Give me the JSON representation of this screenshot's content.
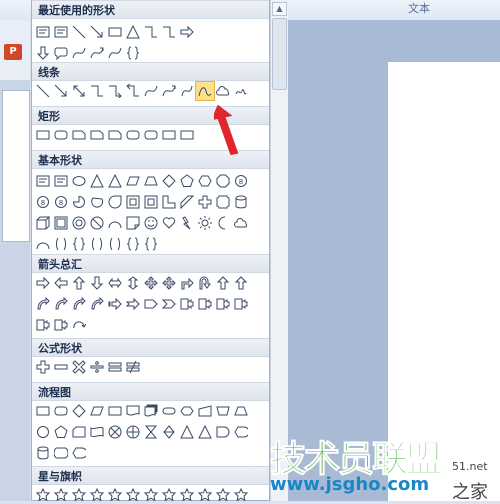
{
  "ribbon": {
    "text_tab": "文本"
  },
  "app": {
    "icon_glyph": "P"
  },
  "watermark": {
    "line1": "技术员联盟",
    "line2": "www.jsgho.com",
    "site_suffix": "51.net",
    "line3": "之家"
  },
  "sections": [
    {
      "title": "最近使用的形状",
      "rows": [
        [
          "textbox",
          "textbox",
          "line",
          "arrow-line",
          "rect",
          "triangle",
          "elbow",
          "elbow",
          "arrow-right"
        ],
        [
          "arrow-down",
          "rounded-callout",
          "curve",
          "curved-arrow",
          "curve",
          "brace"
        ]
      ]
    },
    {
      "title": "线条",
      "rows": [
        [
          "line",
          "arrow-line",
          "dbl-arrow-line",
          "elbow",
          "elbow-arrow",
          "elbow-dbl",
          "curve",
          "curved-arrow",
          "curved-dbl",
          "freeform-selected",
          "cloud",
          "scribble"
        ]
      ]
    },
    {
      "title": "矩形",
      "rows": [
        [
          "rect",
          "round-rect",
          "snip-rect",
          "snip-rect",
          "snip-rect",
          "round-rect",
          "round-rect",
          "rect",
          "rect"
        ]
      ]
    },
    {
      "title": "基本形状",
      "rows": [
        [
          "textbox",
          "textbox",
          "ellipse",
          "triangle",
          "triangle",
          "parallelogram",
          "trapezoid",
          "diamond",
          "pentagon",
          "hexagon",
          "octagon",
          "circle-num"
        ],
        [
          "circle-num",
          "circle-num",
          "pie",
          "chord",
          "teardrop",
          "frame",
          "frame",
          "lshape",
          "diag-stripe",
          "plus",
          "plaque",
          "can"
        ],
        [
          "cube",
          "bevel",
          "donut",
          "noentry",
          "arc",
          "folded",
          "smiley",
          "heart",
          "lightning",
          "sun",
          "moon",
          "cloud"
        ],
        [
          "arc",
          "bracket",
          "brace",
          "bracket",
          "bracket",
          "brace",
          "brace"
        ]
      ]
    },
    {
      "title": "箭头总汇",
      "rows": [
        [
          "arrow-right",
          "arrow-left",
          "arrow-up",
          "arrow-down",
          "arrow-lr",
          "arrow-ud",
          "arrow-quad",
          "arrow-quad",
          "arrow-bent",
          "arrow-uturn",
          "arrow-up",
          "arrow-up"
        ],
        [
          "arrow-curve",
          "arrow-curve",
          "arrow-curve",
          "arrow-curve",
          "arrow-striped",
          "arrow-notch",
          "pentagon-arrow",
          "chevron",
          "callout",
          "callout",
          "callout",
          "callout"
        ],
        [
          "callout",
          "callout",
          "circular-arrow"
        ]
      ]
    },
    {
      "title": "公式形状",
      "rows": [
        [
          "plus",
          "minus",
          "multiply",
          "divide",
          "equal",
          "notequal"
        ]
      ]
    },
    {
      "title": "流程图",
      "rows": [
        [
          "rect",
          "round-rect",
          "diamond",
          "parallelogram",
          "rect",
          "doc",
          "multidoc",
          "terminator",
          "prep",
          "manual-input",
          "manual-op",
          "trapezoid"
        ],
        [
          "circle",
          "pentagon",
          "card",
          "tape",
          "summing",
          "or",
          "collate",
          "sort",
          "triangle",
          "triangle",
          "delay",
          "display"
        ],
        [
          "cylinder",
          "drum",
          "display"
        ]
      ]
    },
    {
      "title": "星与旗帜",
      "rows": [
        [
          "star",
          "star",
          "star",
          "star",
          "star",
          "star",
          "star",
          "star",
          "star",
          "star",
          "star",
          "star"
        ]
      ]
    }
  ]
}
